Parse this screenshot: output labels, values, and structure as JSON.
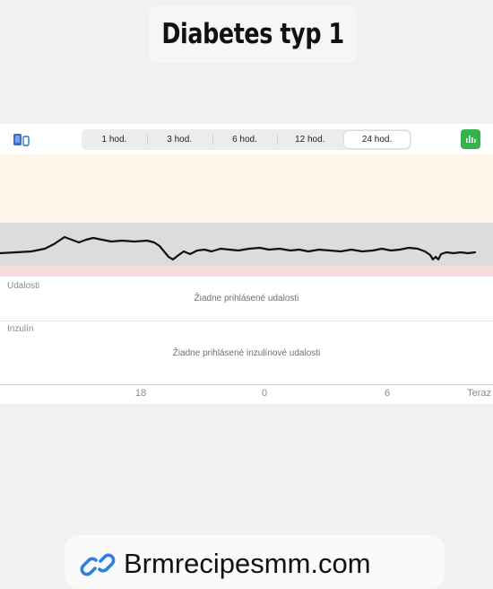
{
  "title": "Diabetes typ 1",
  "toolbar": {
    "device_icon": "phone-device-icon",
    "ranges": [
      "1 hod.",
      "3 hod.",
      "6 hod.",
      "12 hod.",
      "24 hod."
    ],
    "selected": "24 hod.",
    "chart_button_icon": "bar-chart-icon"
  },
  "colors": {
    "high_zone": "#fef5ea",
    "target_zone": "#dcdcdc",
    "low_zone": "#f6dcdc",
    "accent_green": "#35b24c",
    "device_blue": "#2f6fd6"
  },
  "events": {
    "label": "Udalosti",
    "empty": "Žiadne prihlásené udalosti"
  },
  "insulin": {
    "label": "Inzulín",
    "empty": "Žiadne prihlásené inzulínové udalosti"
  },
  "axis": {
    "ticks": [
      "18",
      "0",
      "6"
    ],
    "end": "Teraz"
  },
  "link": {
    "icon": "link-icon",
    "text": "Brmrecipesmm.com"
  }
}
